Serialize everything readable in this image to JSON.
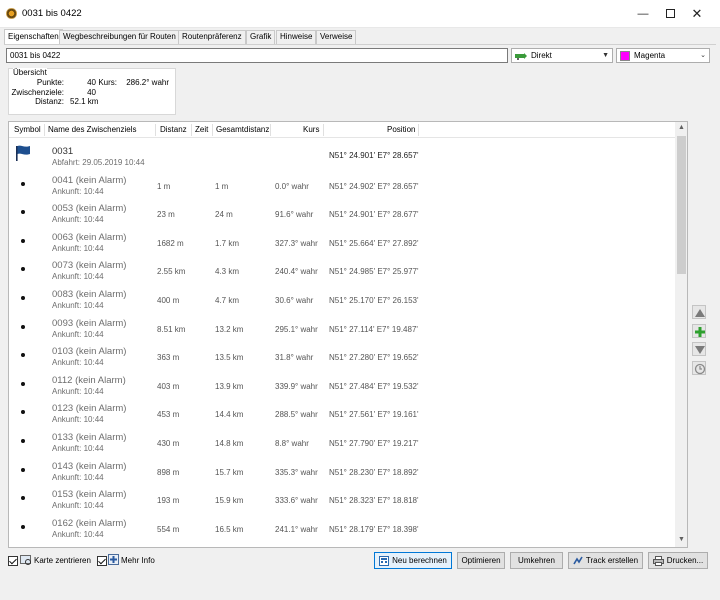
{
  "window": {
    "title": "0031 bis 0422"
  },
  "tabs": [
    {
      "label": "Eigenschaften",
      "active": true
    },
    {
      "label": "Wegbeschreibungen für Routen",
      "active": false
    },
    {
      "label": "Routenpräferenz",
      "active": false
    },
    {
      "label": "Grafik",
      "active": false
    },
    {
      "label": "Hinweise",
      "active": false
    },
    {
      "label": "Verweise",
      "active": false
    }
  ],
  "route": {
    "name_value": "0031 bis 0422",
    "mode": "Direkt",
    "color": "Magenta",
    "color_hex": "#ff00ff"
  },
  "overview": {
    "title": "Übersicht",
    "points_label": "Punkte:",
    "points_value": "40",
    "waypoints_label": "Zwischenziele:",
    "waypoints_value": "40",
    "distance_label": "Distanz:",
    "distance_value": "52.1 km",
    "course_label": "Kurs:",
    "course_value": "286.2° wahr"
  },
  "columns": {
    "symbol": "Symbol",
    "name": "Name des Zwischenziels",
    "distance": "Distanz",
    "time": "Zeit",
    "total": "Gesamtdistanz",
    "course": "Kurs",
    "position": "Position"
  },
  "rows": [
    {
      "name": "0031",
      "sub": "Abfahrt: 29.05.2019 10:44",
      "dist": "",
      "total": "",
      "course": "",
      "pos": "N51° 24.901' E7° 28.657'",
      "symbol": "flag-icon"
    },
    {
      "name": "0041 (kein Alarm)",
      "sub": "Ankunft: 10:44",
      "dist": "1 m",
      "total": "1 m",
      "course": "0.0° wahr",
      "pos": "N51° 24.902' E7° 28.657'",
      "symbol": "dot-icon"
    },
    {
      "name": "0053 (kein Alarm)",
      "sub": "Ankunft: 10:44",
      "dist": "23 m",
      "total": "24 m",
      "course": "91.6° wahr",
      "pos": "N51° 24.901' E7° 28.677'",
      "symbol": "dot-icon"
    },
    {
      "name": "0063 (kein Alarm)",
      "sub": "Ankunft: 10:44",
      "dist": "1682 m",
      "total": "1.7 km",
      "course": "327.3° wahr",
      "pos": "N51° 25.664' E7° 27.892'",
      "symbol": "dot-icon"
    },
    {
      "name": "0073 (kein Alarm)",
      "sub": "Ankunft: 10:44",
      "dist": "2.55 km",
      "total": "4.3 km",
      "course": "240.4° wahr",
      "pos": "N51° 24.985' E7° 25.977'",
      "symbol": "dot-icon"
    },
    {
      "name": "0083 (kein Alarm)",
      "sub": "Ankunft: 10:44",
      "dist": "400 m",
      "total": "4.7 km",
      "course": "30.6° wahr",
      "pos": "N51° 25.170' E7° 26.153'",
      "symbol": "dot-icon"
    },
    {
      "name": "0093 (kein Alarm)",
      "sub": "Ankunft: 10:44",
      "dist": "8.51 km",
      "total": "13.2 km",
      "course": "295.1° wahr",
      "pos": "N51° 27.114' E7° 19.487'",
      "symbol": "dot-icon"
    },
    {
      "name": "0103 (kein Alarm)",
      "sub": "Ankunft: 10:44",
      "dist": "363 m",
      "total": "13.5 km",
      "course": "31.8° wahr",
      "pos": "N51° 27.280' E7° 19.652'",
      "symbol": "dot-icon"
    },
    {
      "name": "0112 (kein Alarm)",
      "sub": "Ankunft: 10:44",
      "dist": "403 m",
      "total": "13.9 km",
      "course": "339.9° wahr",
      "pos": "N51° 27.484' E7° 19.532'",
      "symbol": "dot-icon"
    },
    {
      "name": "0123 (kein Alarm)",
      "sub": "Ankunft: 10:44",
      "dist": "453 m",
      "total": "14.4 km",
      "course": "288.5° wahr",
      "pos": "N51° 27.561' E7° 19.161'",
      "symbol": "dot-icon"
    },
    {
      "name": "0133 (kein Alarm)",
      "sub": "Ankunft: 10:44",
      "dist": "430 m",
      "total": "14.8 km",
      "course": "8.8° wahr",
      "pos": "N51° 27.790' E7° 19.217'",
      "symbol": "dot-icon"
    },
    {
      "name": "0143 (kein Alarm)",
      "sub": "Ankunft: 10:44",
      "dist": "898 m",
      "total": "15.7 km",
      "course": "335.3° wahr",
      "pos": "N51° 28.230' E7° 18.892'",
      "symbol": "dot-icon"
    },
    {
      "name": "0153 (kein Alarm)",
      "sub": "Ankunft: 10:44",
      "dist": "193 m",
      "total": "15.9 km",
      "course": "333.6° wahr",
      "pos": "N51° 28.323' E7° 18.818'",
      "symbol": "dot-icon"
    },
    {
      "name": "0162 (kein Alarm)",
      "sub": "Ankunft: 10:44",
      "dist": "554 m",
      "total": "16.5 km",
      "course": "241.1° wahr",
      "pos": "N51° 28.179' E7° 18.398'",
      "symbol": "dot-icon"
    }
  ],
  "footer": {
    "center_map_label": "Karte zentrieren",
    "more_info_label": "Mehr Info",
    "recalc_label": "Neu berechnen",
    "optimize_label": "Optimieren",
    "reverse_label": "Umkehren",
    "create_track_label": "Track erstellen",
    "print_label": "Drucken..."
  }
}
